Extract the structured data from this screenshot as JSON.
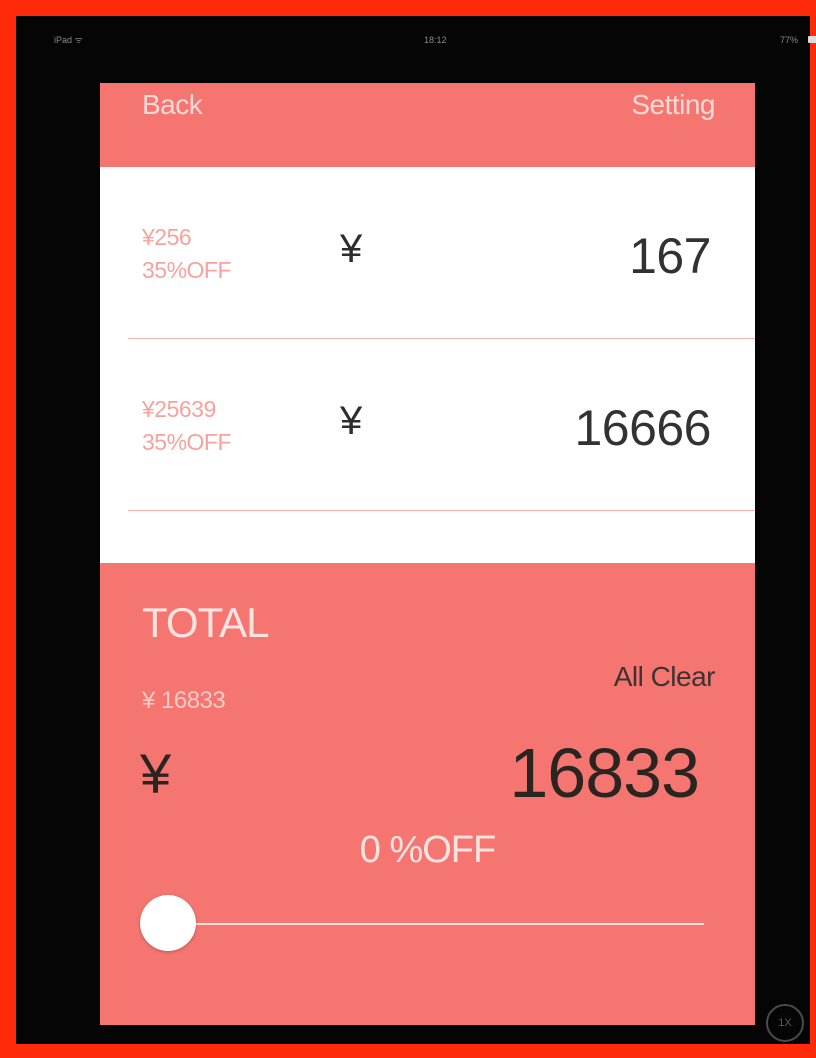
{
  "statusbar": {
    "carrier": "iPad ᯤ",
    "time": "18:12",
    "battery": "77%"
  },
  "navbar": {
    "back_label": "Back",
    "setting_label": "Setting"
  },
  "items": [
    {
      "original": "¥256",
      "discount": "35%OFF",
      "currency": "¥",
      "amount": "167"
    },
    {
      "original": "¥25639",
      "discount": "35%OFF",
      "currency": "¥",
      "amount": "16666"
    }
  ],
  "total": {
    "title": "TOTAL",
    "subtotal": "¥ 16833",
    "all_clear_label": "All Clear",
    "currency": "¥",
    "amount": "16833",
    "discount_label": "0 %OFF",
    "slider_value_percent": 0
  },
  "zoom_badge": "1X",
  "colors": {
    "frame": "#ff2a0a",
    "accent": "#f57670",
    "background": "#050505"
  }
}
